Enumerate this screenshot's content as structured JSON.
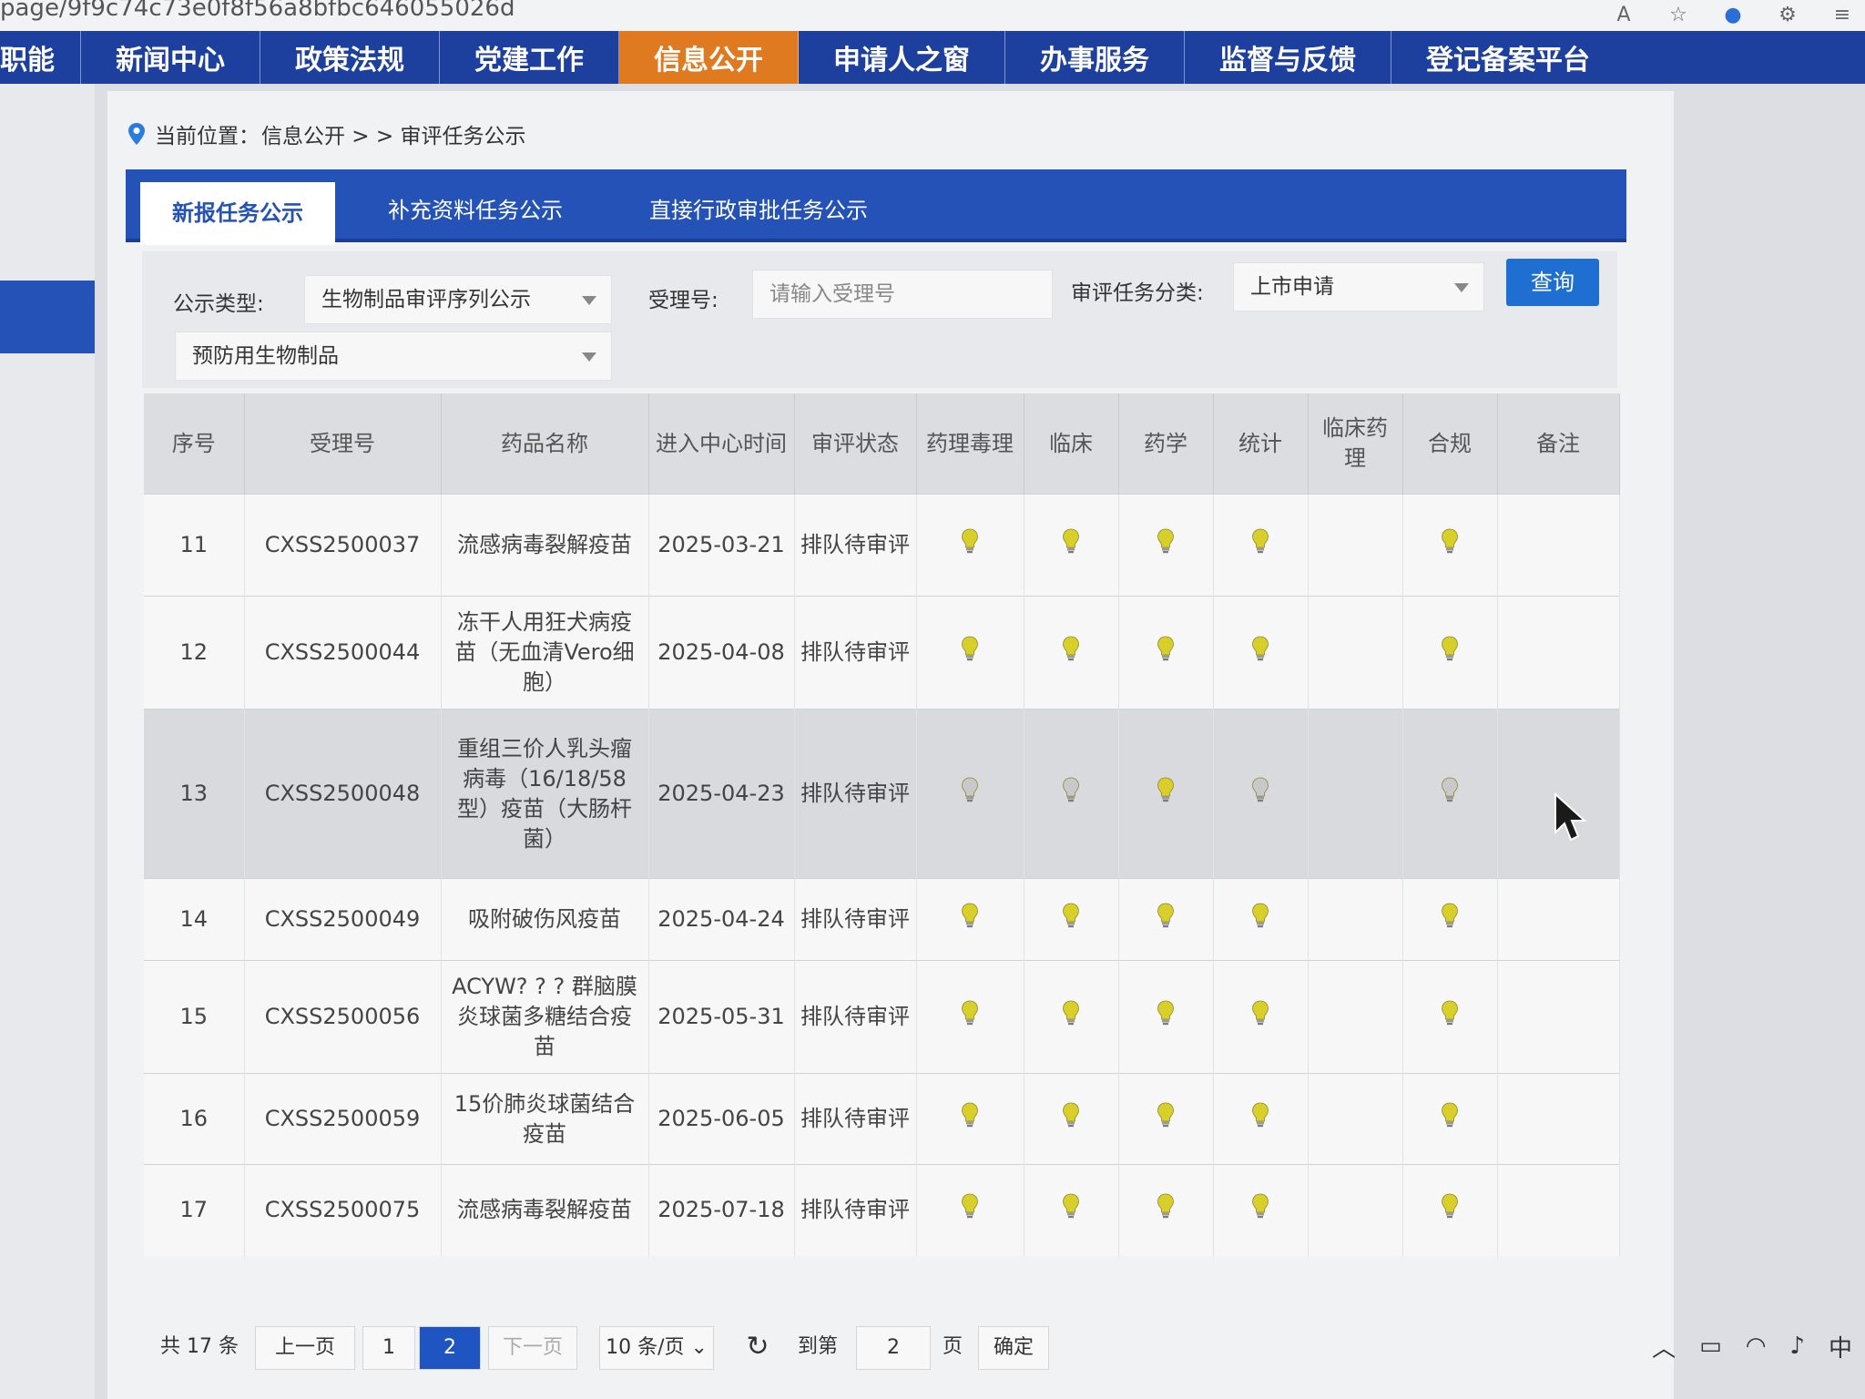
{
  "browser": {
    "url": "page/9f9c74c73e0f8f56a8bfbc646055026d"
  },
  "topnav": {
    "items": [
      "职能",
      "新闻中心",
      "政策法规",
      "党建工作",
      "信息公开",
      "申请人之窗",
      "办事服务",
      "监督与反馈",
      "登记备案平台"
    ],
    "active_index": 4
  },
  "breadcrumb": {
    "prefix": "当前位置：",
    "path": "信息公开 > > 审评任务公示"
  },
  "tabs": [
    "新报任务公示",
    "补充资料任务公示",
    "直接行政审批任务公示"
  ],
  "filters": {
    "type_label": "公示类型:",
    "type_value": "生物制品审评序列公示",
    "accept_label": "受理号:",
    "accept_placeholder": "请输入受理号",
    "category_label": "审评任务分类:",
    "category_value": "上市申请",
    "subtype_value": "预防用生物制品",
    "query_button": "查询"
  },
  "table": {
    "headers": [
      "序号",
      "受理号",
      "药品名称",
      "进入中心时间",
      "审评状态",
      "药理毒理",
      "临床",
      "药学",
      "统计",
      "临床药理",
      "合规",
      "备注"
    ],
    "rows": [
      {
        "no": "11",
        "id": "CXSS2500037",
        "name": "流感病毒裂解疫苗",
        "date": "2025-03-21",
        "status": "排队待审评",
        "bulbs": [
          true,
          true,
          true,
          true,
          null,
          true
        ]
      },
      {
        "no": "12",
        "id": "CXSS2500044",
        "name": "冻干人用狂犬病疫苗（无血清Vero细胞）",
        "date": "2025-04-08",
        "status": "排队待审评",
        "bulbs": [
          true,
          true,
          true,
          true,
          null,
          true
        ]
      },
      {
        "no": "13",
        "id": "CXSS2500048",
        "name": "重组三价人乳头瘤病毒（16/18/58型）疫苗（大肠杆菌）",
        "date": "2025-04-23",
        "status": "排队待审评",
        "bulbs": [
          false,
          false,
          true,
          false,
          null,
          false
        ]
      },
      {
        "no": "14",
        "id": "CXSS2500049",
        "name": "吸附破伤风疫苗",
        "date": "2025-04-24",
        "status": "排队待审评",
        "bulbs": [
          true,
          true,
          true,
          true,
          null,
          true
        ]
      },
      {
        "no": "15",
        "id": "CXSS2500056",
        "name": "ACYW? ? ? 群脑膜炎球菌多糖结合疫苗",
        "date": "2025-05-31",
        "status": "排队待审评",
        "bulbs": [
          true,
          true,
          true,
          true,
          null,
          true
        ]
      },
      {
        "no": "16",
        "id": "CXSS2500059",
        "name": "15价肺炎球菌结合疫苗",
        "date": "2025-06-05",
        "status": "排队待审评",
        "bulbs": [
          true,
          true,
          true,
          true,
          null,
          true
        ]
      },
      {
        "no": "17",
        "id": "CXSS2500075",
        "name": "流感病毒裂解疫苗",
        "date": "2025-07-18",
        "status": "排队待审评",
        "bulbs": [
          true,
          true,
          true,
          true,
          null,
          true
        ]
      }
    ]
  },
  "pager": {
    "total": "共 17 条",
    "prev": "上一页",
    "page1": "1",
    "page2": "2",
    "next": "下一页",
    "per_page": "10 条/页",
    "goto": "到第",
    "goto_value": "2",
    "page_word": "页",
    "confirm": "确定"
  },
  "tray": {
    "ime": "中"
  },
  "colors": {
    "nav": "#1d3f9e",
    "active_nav": "#e07a21",
    "tabs": "#2452b6",
    "bulb_on": "#d8cf2a",
    "bulb_off": "#c9c9cc"
  }
}
